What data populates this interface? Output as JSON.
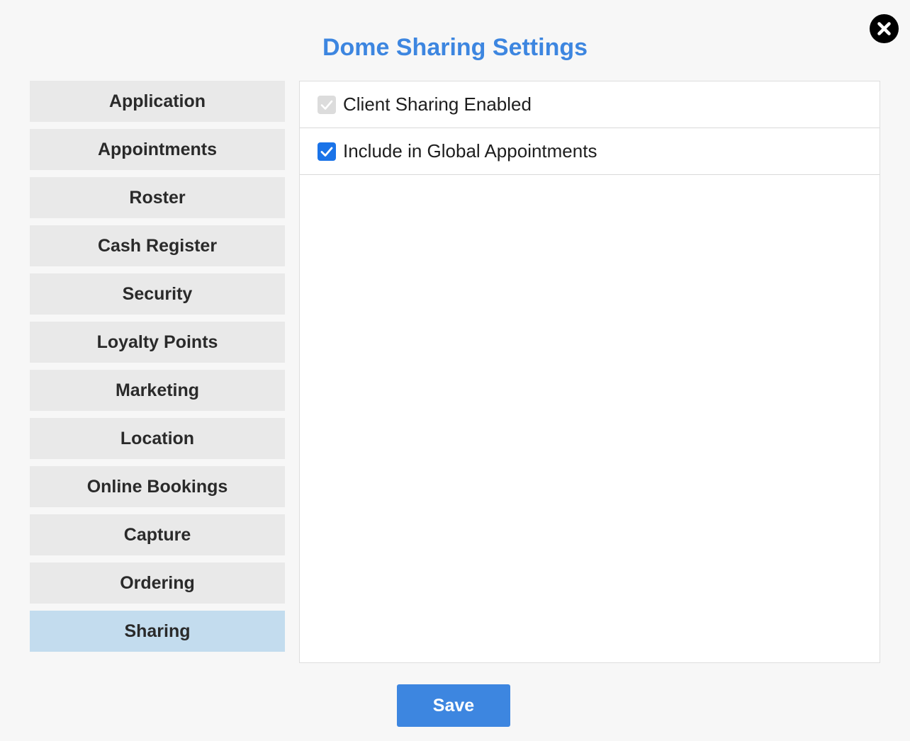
{
  "dialog": {
    "title": "Dome Sharing Settings",
    "close_icon": "close-icon"
  },
  "sidebar": {
    "items": [
      {
        "label": "Application",
        "active": false
      },
      {
        "label": "Appointments",
        "active": false
      },
      {
        "label": "Roster",
        "active": false
      },
      {
        "label": "Cash Register",
        "active": false
      },
      {
        "label": "Security",
        "active": false
      },
      {
        "label": "Loyalty Points",
        "active": false
      },
      {
        "label": "Marketing",
        "active": false
      },
      {
        "label": "Location",
        "active": false
      },
      {
        "label": "Online Bookings",
        "active": false
      },
      {
        "label": "Capture",
        "active": false
      },
      {
        "label": "Ordering",
        "active": false
      },
      {
        "label": "Sharing",
        "active": true
      }
    ]
  },
  "settings": {
    "options": [
      {
        "label": "Client Sharing Enabled",
        "checked": true,
        "disabled": true
      },
      {
        "label": "Include in Global Appointments",
        "checked": true,
        "disabled": false
      }
    ]
  },
  "footer": {
    "save_label": "Save"
  },
  "colors": {
    "accent": "#3d86e0",
    "active_tab": "#c3dcee",
    "inactive_tab": "#e9e9e9",
    "checkbox_checked": "#1a73e8",
    "checkbox_disabled": "#dcdcdc"
  }
}
